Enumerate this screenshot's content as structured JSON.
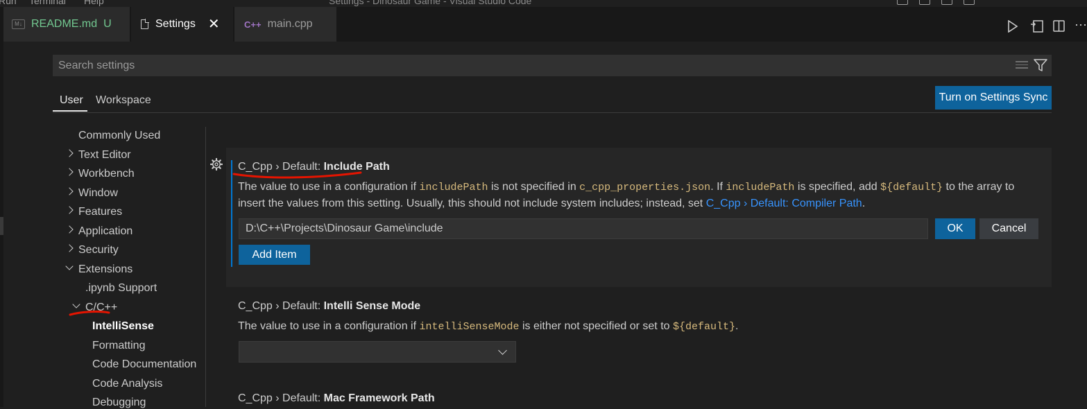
{
  "window": {
    "title": "Settings - Dinosaur Game - Visual Studio Code",
    "menu": [
      "Run",
      "Terminal",
      "Help"
    ]
  },
  "tabs": [
    {
      "label": "README.md",
      "badge": "U",
      "icon": "markdown-icon",
      "active": false
    },
    {
      "label": "Settings",
      "icon": "file-icon",
      "active": true
    },
    {
      "label": "main.cpp",
      "icon": "cpp-icon",
      "active": false
    }
  ],
  "tab_icons": {
    "markdown_badge": "M↓",
    "cpp_badge": "C++"
  },
  "colors": {
    "accent": "#0e639c",
    "link": "#3794ff",
    "code": "#d7ba7d",
    "untracked": "#73c991",
    "annotation": "#e51400"
  },
  "search": {
    "placeholder": "Search settings",
    "value": ""
  },
  "scope": {
    "user": "User",
    "workspace": "Workspace"
  },
  "sync_button": "Turn on Settings Sync",
  "toc": [
    {
      "label": "Commonly Used",
      "chevron": "none"
    },
    {
      "label": "Text Editor",
      "chevron": "right"
    },
    {
      "label": "Workbench",
      "chevron": "right"
    },
    {
      "label": "Window",
      "chevron": "right"
    },
    {
      "label": "Features",
      "chevron": "right"
    },
    {
      "label": "Application",
      "chevron": "right"
    },
    {
      "label": "Security",
      "chevron": "right"
    },
    {
      "label": "Extensions",
      "chevron": "down"
    },
    {
      "label": ".ipynb Support",
      "chevron": "none"
    },
    {
      "label": "C/C++",
      "chevron": "down"
    },
    {
      "label": "IntelliSense",
      "chevron": "none",
      "selected": true
    },
    {
      "label": "Formatting",
      "chevron": "none"
    },
    {
      "label": "Code Documentation",
      "chevron": "none"
    },
    {
      "label": "Code Analysis",
      "chevron": "none"
    },
    {
      "label": "Debugging",
      "chevron": "none"
    }
  ],
  "settings": {
    "include_path": {
      "prefix": "C_Cpp › Default: ",
      "name": "Include Path",
      "desc": {
        "t1": "The value to use in a configuration if ",
        "c1": "includePath",
        "t2": " is not specified in ",
        "c2": "c_cpp_properties.json",
        "t3": ". If ",
        "c3": "includePath",
        "t4": " is specified, add ",
        "c4": "${default}",
        "t5": " to the array to insert the values from this setting. Usually, this should not include system includes; instead, set ",
        "link": "C_Cpp › Default: Compiler Path",
        "t6": "."
      },
      "item_value": "D:\\C++\\Projects\\Dinosaur Game\\include",
      "ok": "OK",
      "cancel": "Cancel",
      "add_item": "Add Item"
    },
    "intellisense_mode": {
      "prefix": "C_Cpp › Default: ",
      "name": "Intelli Sense Mode",
      "desc": {
        "t1": "The value to use in a configuration if ",
        "c1": "intelliSenseMode",
        "t2": " is either not specified or set to ",
        "c2": "${default}",
        "t3": "."
      },
      "value": ""
    },
    "mac_framework_path": {
      "prefix": "C_Cpp › Default: ",
      "name": "Mac Framework Path"
    }
  }
}
